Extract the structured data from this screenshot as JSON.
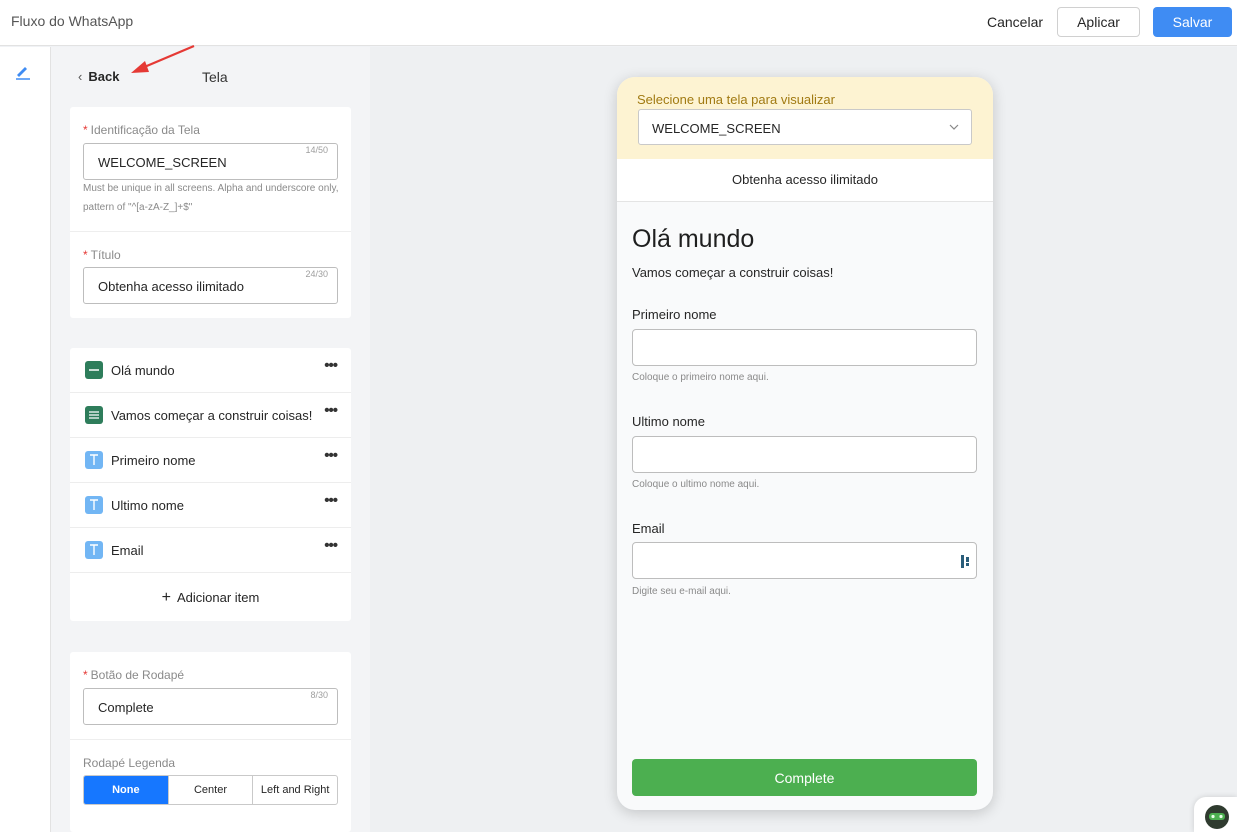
{
  "app": {
    "title": "Fluxo do WhatsApp"
  },
  "topbar": {
    "cancel_label": "Cancelar",
    "apply_label": "Aplicar",
    "save_label": "Salvar"
  },
  "panel": {
    "back_label": "Back",
    "title": "Tela",
    "screen_id": {
      "label": "Identificação da Tela",
      "value": "WELCOME_SCREEN",
      "counter": "14/50",
      "help": "Must be unique in all screens. Alpha and underscore only, pattern of \"^[a-zA-Z_]+$\""
    },
    "title_field": {
      "label": "Título",
      "value": "Obtenha acesso ilimitado",
      "counter": "24/30"
    },
    "items": [
      {
        "label": "Olá mundo",
        "icon": "heading-icon"
      },
      {
        "label": "Vamos começar a construir coisas!",
        "icon": "body-text-icon"
      },
      {
        "label": "Primeiro nome",
        "icon": "text-input-icon"
      },
      {
        "label": "Ultimo nome",
        "icon": "text-input-icon"
      },
      {
        "label": "Email",
        "icon": "text-input-icon"
      }
    ],
    "add_item_label": "Adicionar item",
    "footer_button": {
      "label": "Botão de Rodapé",
      "value": "Complete",
      "counter": "8/30"
    },
    "footer_caption": {
      "label": "Rodapé Legenda",
      "options": [
        "None",
        "Center",
        "Left and Right"
      ],
      "selected": "None"
    }
  },
  "preview": {
    "select_label": "Selecione uma tela para visualizar",
    "selected_screen": "WELCOME_SCREEN",
    "screen_title": "Obtenha acesso ilimitado",
    "heading": "Olá mundo",
    "body": "Vamos começar a construir coisas!",
    "fields": [
      {
        "label": "Primeiro nome",
        "help": "Coloque o primeiro nome aqui."
      },
      {
        "label": "Ultimo nome",
        "help": "Coloque o ultimo nome aqui."
      },
      {
        "label": "Email",
        "help": "Digite seu e-mail aqui."
      }
    ],
    "footer_button": "Complete"
  },
  "colors": {
    "primary": "#3f8cf3",
    "segment_active": "#1677ff",
    "complete_button": "#4caf50",
    "select_bg": "#fdf3d2",
    "required": "#e53935",
    "arrow": "#e53935"
  }
}
